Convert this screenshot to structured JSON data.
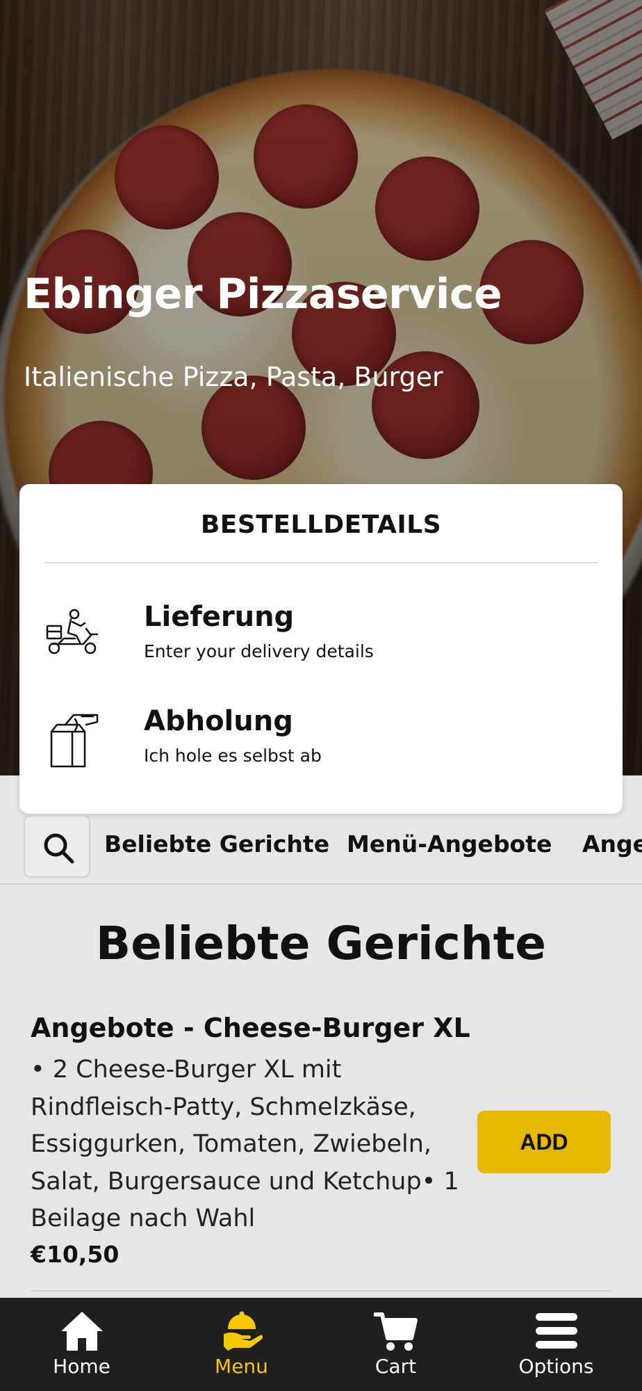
{
  "hero": {
    "title": "Ebinger Pizzaservice",
    "subtitle": "Italienische Pizza, Pasta, Burger"
  },
  "order_card": {
    "title": "BESTELLDETAILS",
    "options": [
      {
        "label": "Lieferung",
        "description": "Enter your delivery details",
        "icon": "delivery-scooter-icon"
      },
      {
        "label": "Abholung",
        "description": "Ich hole es selbst ab",
        "icon": "takeaway-bag-icon"
      }
    ]
  },
  "categories": {
    "search_icon": "search-icon",
    "items": [
      "Beliebte Gerichte",
      "Menü-Angebote",
      "Ange"
    ]
  },
  "section": {
    "title": "Beliebte Gerichte",
    "item": {
      "title": "Angebote - Cheese-Burger XL",
      "description": "• 2 Cheese-Burger XL mit Rindfleisch-Patty, Schmelzkäse, Essiggurken, Tomaten, Zwiebeln, Salat, Burgersauce und Ketchup• 1 Beilage nach Wahl",
      "price": "€10,50",
      "add_label": "ADD"
    }
  },
  "bottom_nav": {
    "items": [
      {
        "label": "Home",
        "icon": "home-icon",
        "active": false
      },
      {
        "label": "Menu",
        "icon": "menu-dish-icon",
        "active": true
      },
      {
        "label": "Cart",
        "icon": "cart-icon",
        "active": false
      },
      {
        "label": "Options",
        "icon": "hamburger-menu-icon",
        "active": false
      }
    ]
  },
  "colors": {
    "accent": "#e6b800",
    "nav_active": "#f5c800",
    "nav_background": "#1f1f1f",
    "page_background": "#e6e6e6"
  }
}
